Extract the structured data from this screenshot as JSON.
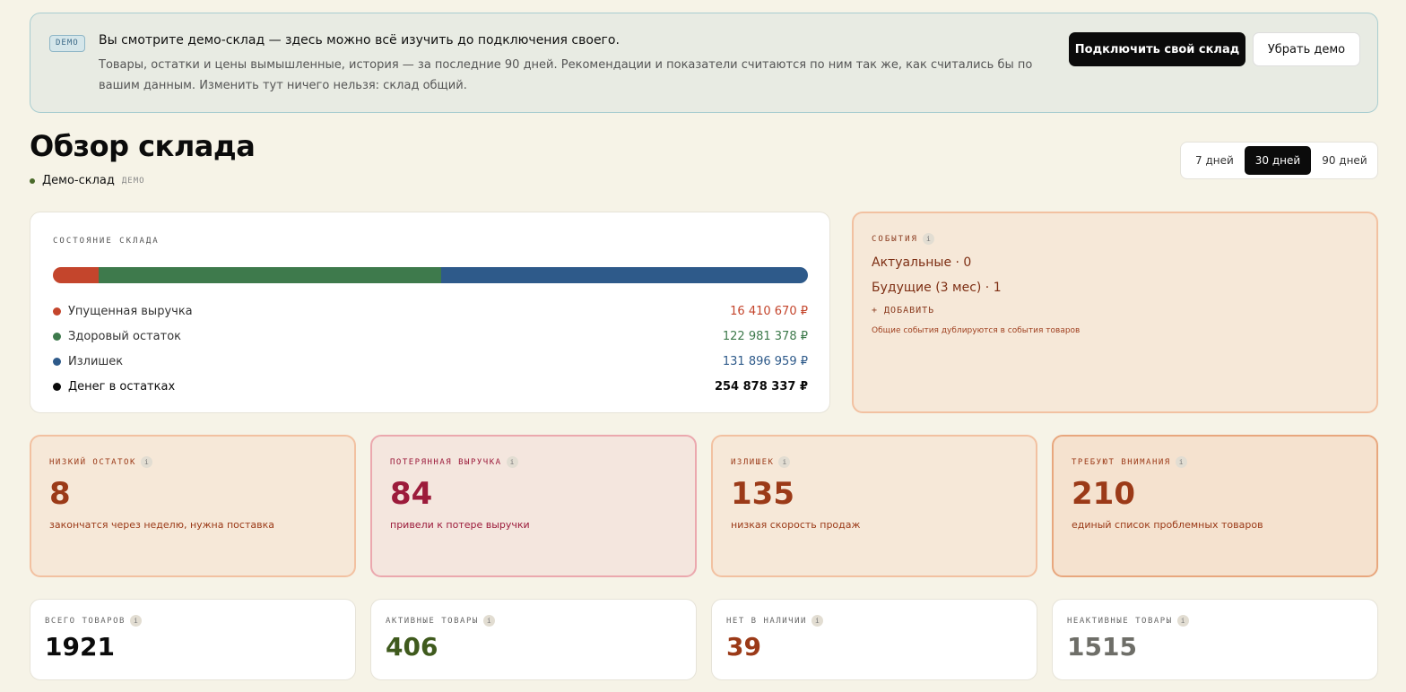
{
  "banner": {
    "badge": "DEMO",
    "headline": "Вы смотрите демо-склад — здесь можно всё изучить до подключения своего.",
    "description": "Товары, остатки и цены вымышленные, история — за последние 90 дней. Рекомендации и показатели считаются по ним так же, как считались бы по вашим данным. Изменить тут ничего нельзя: склад общий.",
    "connect_label": "Подключить свой склад",
    "remove_label": "Убрать демо"
  },
  "header": {
    "title": "Обзор склада",
    "warehouse_name": "Демо-склад",
    "warehouse_tag": "ДЕМО"
  },
  "period": {
    "options": [
      "7 дней",
      "30 дней",
      "90 дней"
    ],
    "selected": "30 дней"
  },
  "warehouse_state": {
    "label": "СОСТОЯНИЕ СКЛАДА",
    "rows": [
      {
        "name": "Упущенная выручка",
        "value": "16 410 670 ₽",
        "amount": 16410670,
        "color": "#c4452c"
      },
      {
        "name": "Здоровый остаток",
        "value": "122 981 378 ₽",
        "amount": 122981378,
        "color": "#3e7a4c"
      },
      {
        "name": "Излишек",
        "value": "131 896 959 ₽",
        "amount": 131896959,
        "color": "#2e5a8a"
      }
    ],
    "total": {
      "name": "Денег в остатках",
      "value": "254 878 337 ₽",
      "color": "#0b0b0b"
    }
  },
  "events": {
    "label": "СОБЫТИЯ",
    "info": "i",
    "current": "Актуальные · 0",
    "future": "Будущие (3 мес) · 1",
    "add_label": "+ ДОБАВИТЬ",
    "note": "Общие события дублируются в события товаров"
  },
  "metrics": [
    {
      "label": "НИЗКИЙ ОСТАТОК",
      "value": "8",
      "desc": "закончатся через неделю, нужна поставка",
      "color": "#9b3a18",
      "bg": "#f6e8d8",
      "border": "#f2c1a1"
    },
    {
      "label": "ПОТЕРЯННАЯ ВЫРУЧКА",
      "value": "84",
      "desc": "привели к потере выручки",
      "color": "#9c1b3b",
      "bg": "#f4e6de",
      "border": "#eba8ae"
    },
    {
      "label": "ИЗЛИШЕК",
      "value": "135",
      "desc": "низкая скорость продаж",
      "color": "#9b3a18",
      "bg": "#f6e8d8",
      "border": "#f2c1a1"
    },
    {
      "label": "ТРЕБУЮТ ВНИМАНИЯ",
      "value": "210",
      "desc": "единый список проблемных товаров",
      "color": "#9b3a18",
      "bg": "#f5e2cf",
      "border": "#e8a77e"
    }
  ],
  "stats": [
    {
      "label": "ВСЕГО ТОВАРОВ",
      "value": "1921",
      "color": "#0b0b0b"
    },
    {
      "label": "АКТИВНЫЕ ТОВАРЫ",
      "value": "406",
      "color": "#3f5a1d"
    },
    {
      "label": "НЕТ В НАЛИЧИИ",
      "value": "39",
      "color": "#9b3a18"
    },
    {
      "label": "НЕАКТИВНЫЕ ТОВАРЫ",
      "value": "1515",
      "color": "#6e6e68"
    }
  ]
}
